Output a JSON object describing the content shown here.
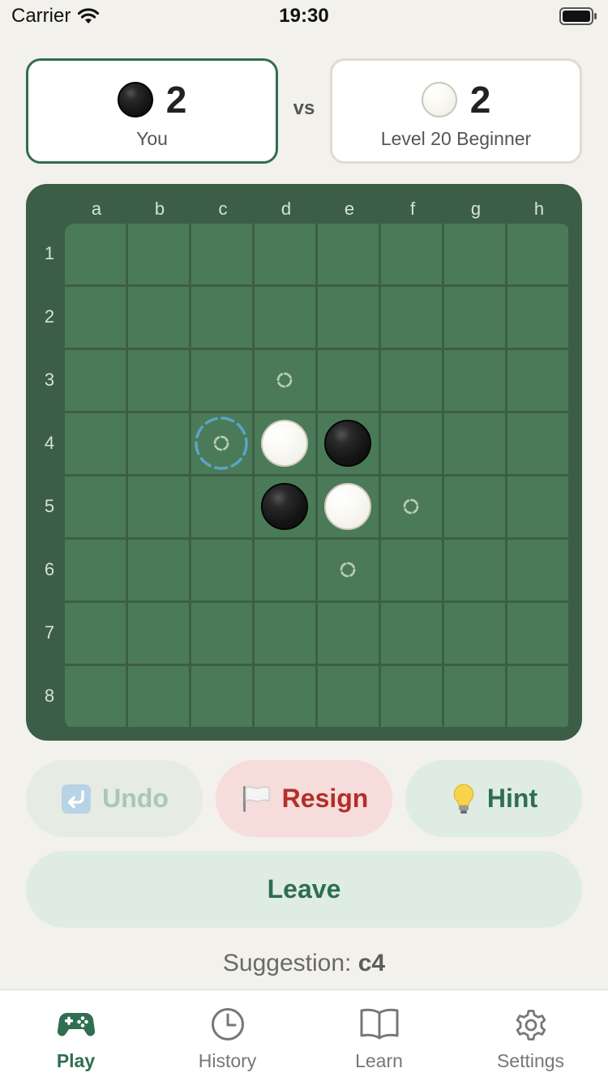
{
  "status_bar": {
    "carrier": "Carrier",
    "time": "19:30"
  },
  "players": {
    "you": {
      "count": "2",
      "name": "You",
      "color": "black"
    },
    "vs": "vs",
    "opponent": {
      "count": "2",
      "name": "Level 20 Beginner",
      "color": "white"
    }
  },
  "board": {
    "columns": [
      "a",
      "b",
      "c",
      "d",
      "e",
      "f",
      "g",
      "h"
    ],
    "rows": [
      "1",
      "2",
      "3",
      "4",
      "5",
      "6",
      "7",
      "8"
    ],
    "pieces": [
      {
        "square": "d4",
        "color": "white"
      },
      {
        "square": "e4",
        "color": "black"
      },
      {
        "square": "d5",
        "color": "black"
      },
      {
        "square": "e5",
        "color": "white"
      }
    ],
    "legal_moves": [
      "d3",
      "f5",
      "e6"
    ],
    "hint_square": "c4"
  },
  "buttons": {
    "undo": {
      "label": "Undo",
      "icon": "undo-icon",
      "enabled": false
    },
    "resign": {
      "label": "Resign",
      "icon": "flag-icon"
    },
    "hint": {
      "label": "Hint",
      "icon": "lightbulb-icon"
    },
    "leave": {
      "label": "Leave"
    }
  },
  "suggestion": {
    "prefix": "Suggestion:",
    "move": "c4"
  },
  "tabs": [
    {
      "label": "Play",
      "icon": "gamepad-icon",
      "active": true
    },
    {
      "label": "History",
      "icon": "clock-icon",
      "active": false
    },
    {
      "label": "Learn",
      "icon": "book-icon",
      "active": false
    },
    {
      "label": "Settings",
      "icon": "gear-icon",
      "active": false
    }
  ],
  "colors": {
    "accent": "#2f6e51",
    "board_frame": "#3c5e46",
    "board_cell": "#4b7a58",
    "resign": "#b32f2a",
    "hint_ring": "#5ba3c7"
  }
}
